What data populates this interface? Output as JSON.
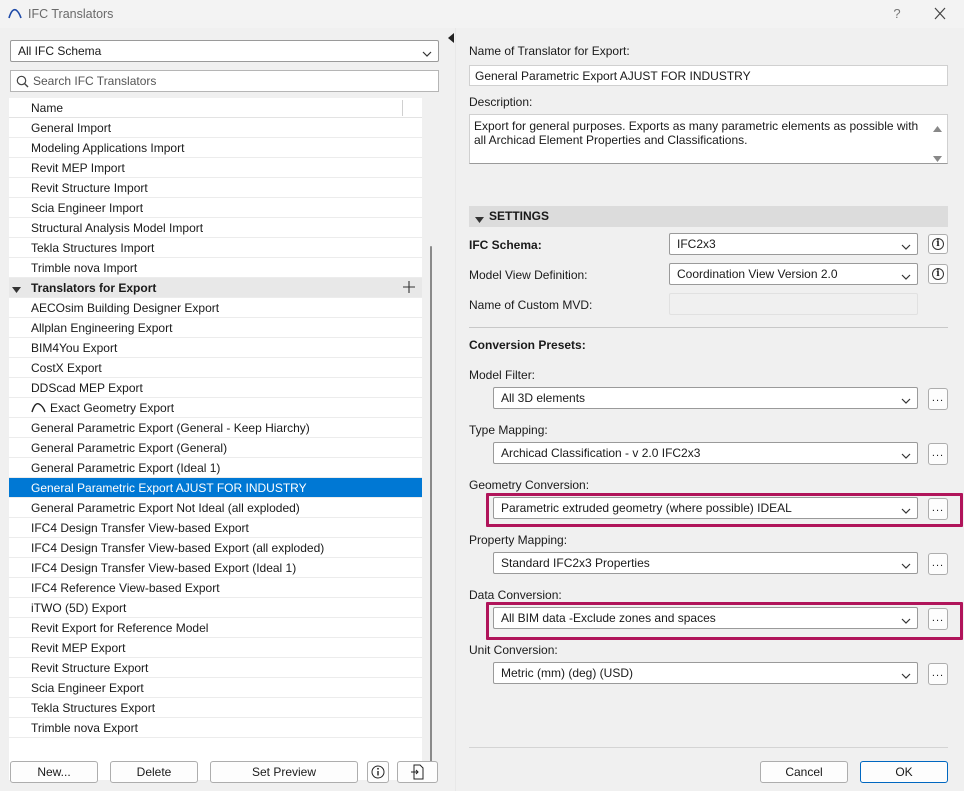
{
  "window": {
    "title": "IFC Translators",
    "help_label": "?"
  },
  "left": {
    "schema_filter": "All IFC Schema",
    "search_placeholder": "Search IFC Translators",
    "column_name": "Name",
    "import_items": [
      "General Import",
      "Modeling Applications Import",
      "Revit MEP Import",
      "Revit Structure Import",
      "Scia Engineer Import",
      "Structural Analysis Model Import",
      "Tekla Structures Import",
      "Trimble nova Import"
    ],
    "export_group_label": "Translators for Export",
    "export_items": [
      "AECOsim Building Designer Export",
      "Allplan Engineering Export",
      "BIM4You Export",
      "CostX Export",
      "DDScad MEP Export",
      "Exact Geometry Export",
      "General Parametric Export (General - Keep Hiarchy)",
      "General Parametric Export (General)",
      "General Parametric Export (Ideal 1)",
      "General Parametric Export AJUST FOR INDUSTRY",
      "General Parametric Export Not Ideal (all exploded)",
      "IFC4 Design Transfer View-based Export",
      "IFC4 Design Transfer View-based Export (all exploded)",
      "IFC4 Design Transfer View-based Export (Ideal 1)",
      "IFC4 Reference View-based Export",
      "iTWO (5D) Export",
      "Revit Export for Reference Model",
      "Revit MEP Export",
      "Revit Structure Export",
      "Scia Engineer Export",
      "Tekla Structures Export",
      "Trimble nova Export"
    ],
    "selected_item": "General Parametric Export AJUST FOR INDUSTRY",
    "buttons": {
      "new": "New...",
      "delete": "Delete",
      "set_preview": "Set Preview"
    }
  },
  "right": {
    "name_label": "Name of Translator for Export:",
    "name_value": "General Parametric Export AJUST FOR INDUSTRY",
    "description_label": "Description:",
    "description_value": "Export for general purposes. Exports as many parametric elements as possible with all Archicad Element Properties and Classifications.",
    "settings_label": "SETTINGS",
    "ifc_schema_label": "IFC Schema:",
    "ifc_schema_value": "IFC2x3",
    "mvd_label": "Model View Definition:",
    "mvd_value": "Coordination View Version 2.0",
    "custom_mvd_label": "Name of Custom MVD:",
    "custom_mvd_value": "",
    "conversion_presets_label": "Conversion Presets:",
    "model_filter_label": "Model Filter:",
    "model_filter_value": "All 3D elements",
    "type_mapping_label": "Type Mapping:",
    "type_mapping_value": "Archicad Classification - v 2.0 IFC2x3",
    "geometry_conversion_label": "Geometry Conversion:",
    "geometry_conversion_value": "Parametric extruded geometry (where possible) IDEAL",
    "property_mapping_label": "Property Mapping:",
    "property_mapping_value": "Standard IFC2x3 Properties",
    "data_conversion_label": "Data Conversion:",
    "data_conversion_value": "All BIM data -Exclude zones and spaces",
    "unit_conversion_label": "Unit Conversion:",
    "unit_conversion_value": "Metric (mm) (deg) (USD)",
    "dots_label": "...",
    "buttons": {
      "cancel": "Cancel",
      "ok": "OK"
    }
  },
  "colors": {
    "selection": "#0078d4",
    "highlight_frame": "#b0145a"
  }
}
